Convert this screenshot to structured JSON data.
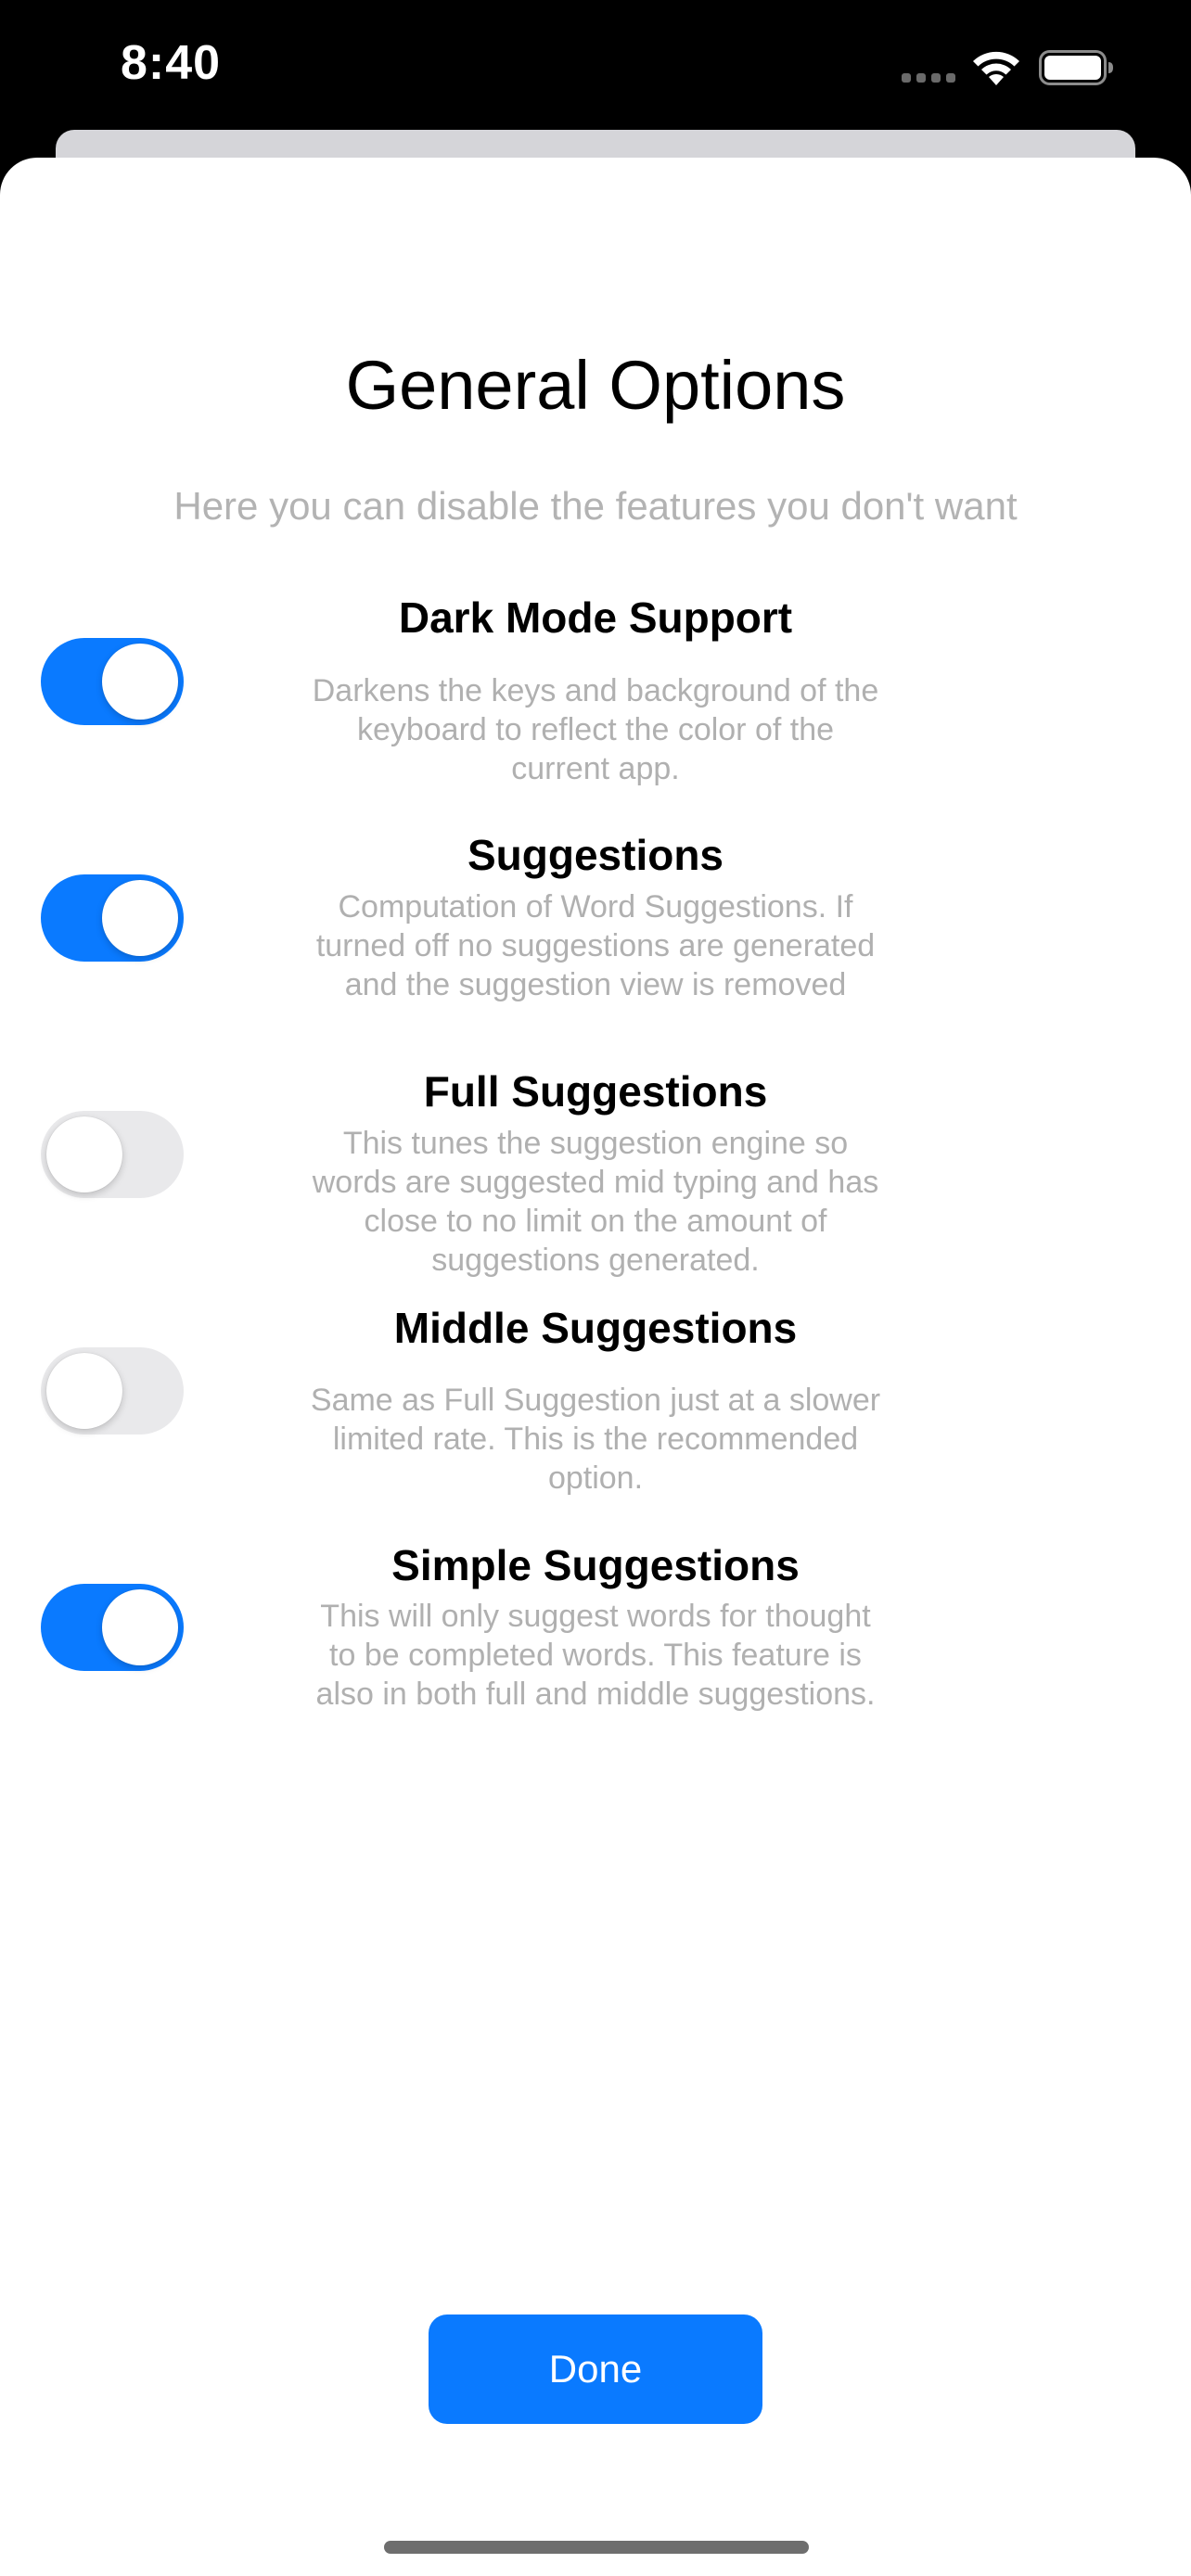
{
  "status_bar": {
    "time": "8:40",
    "icons": [
      "cellular-signal-icon",
      "wifi-icon",
      "battery-icon"
    ]
  },
  "header": {
    "title": "General Options",
    "subtitle": "Here you can disable the features you don't want"
  },
  "options": [
    {
      "title": "Dark Mode Support",
      "description": "Darkens the keys and background of the keyboard to reflect the color of the current app.",
      "enabled": true
    },
    {
      "title": "Suggestions",
      "description": "Computation of Word Suggestions. If turned off no suggestions are generated and the suggestion view is removed",
      "enabled": true
    },
    {
      "title": "Full Suggestions",
      "description": "This tunes the suggestion engine so words are suggested mid typing and has close to no limit on the amount of suggestions generated.",
      "enabled": false
    },
    {
      "title": "Middle Suggestions",
      "description": "Same as Full Suggestion just at a slower limited rate. This is the recommended option.",
      "enabled": false
    },
    {
      "title": "Simple Suggestions",
      "description": "This will only suggest words for thought to be completed words. This feature is also in both full and middle suggestions.",
      "enabled": true
    }
  ],
  "footer": {
    "done_label": "Done"
  },
  "colors": {
    "accent": "#0a7aff",
    "toggle_off": "#e9e9eb",
    "secondary_text": "#b0b0b0"
  }
}
